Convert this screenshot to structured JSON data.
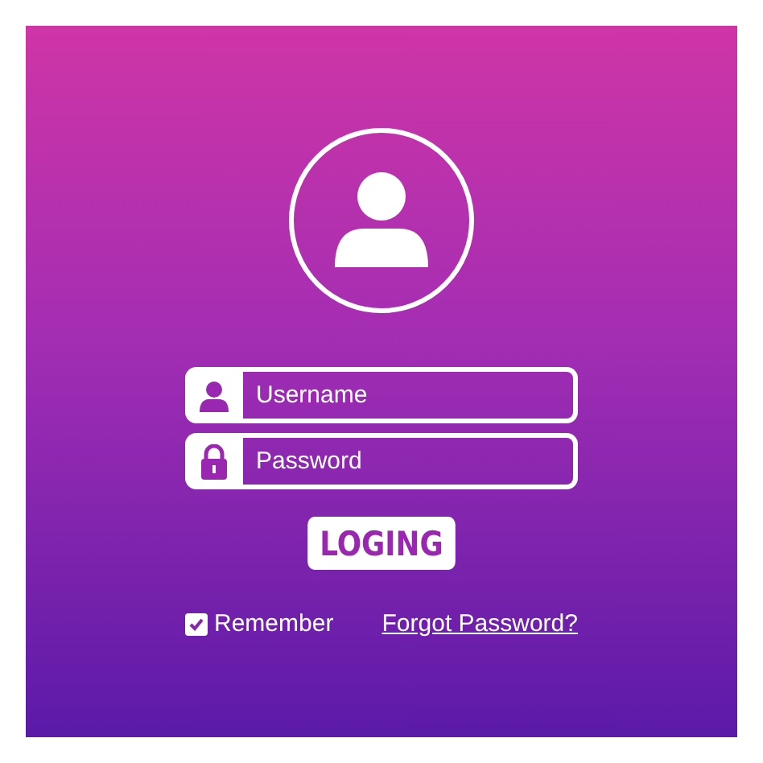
{
  "username": {
    "placeholder": "Username"
  },
  "password": {
    "placeholder": "Password"
  },
  "login_button": "LOGING",
  "remember": {
    "label": "Remember",
    "checked": true
  },
  "forgot_link": "Forgot Password?"
}
